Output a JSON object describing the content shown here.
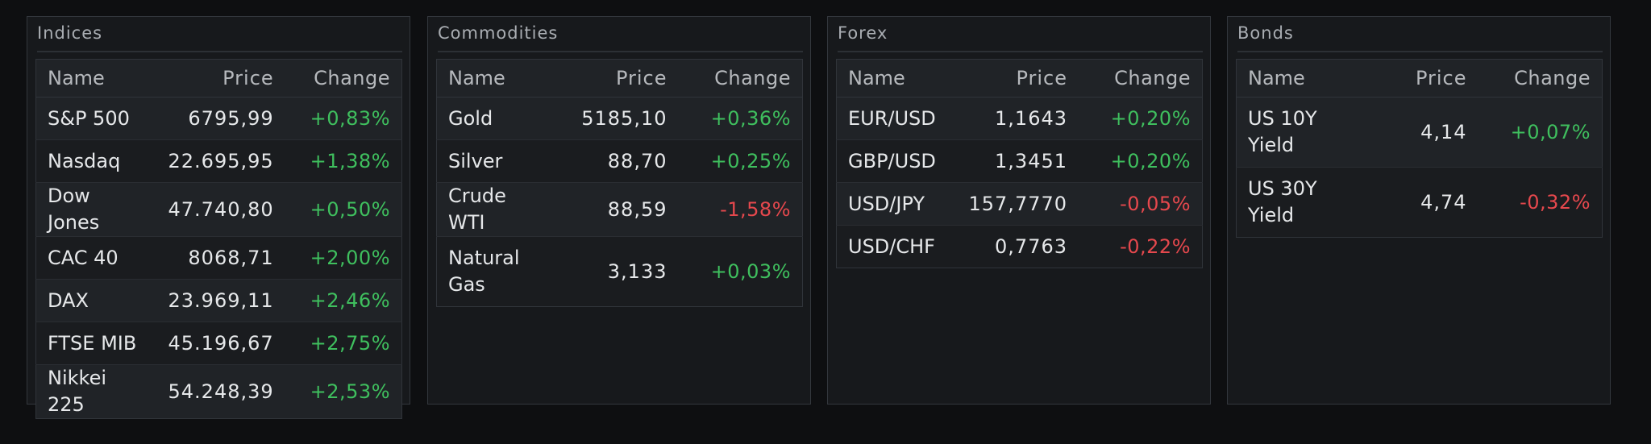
{
  "headers": {
    "name": "Name",
    "price": "Price",
    "change": "Change"
  },
  "panels": [
    {
      "title": "Indices",
      "rows": [
        {
          "name": "S&P 500",
          "price": "6795,99",
          "change": "+0,83%",
          "dir": "up"
        },
        {
          "name": "Nasdaq",
          "price": "22.695,95",
          "change": "+1,38%",
          "dir": "up"
        },
        {
          "name": "Dow Jones",
          "price": "47.740,80",
          "change": "+0,50%",
          "dir": "up"
        },
        {
          "name": "CAC 40",
          "price": "8068,71",
          "change": "+2,00%",
          "dir": "up"
        },
        {
          "name": "DAX",
          "price": "23.969,11",
          "change": "+2,46%",
          "dir": "up"
        },
        {
          "name": "FTSE MIB",
          "price": "45.196,67",
          "change": "+2,75%",
          "dir": "up"
        },
        {
          "name": "Nikkei 225",
          "price": "54.248,39",
          "change": "+2,53%",
          "dir": "up"
        }
      ]
    },
    {
      "title": "Commodities",
      "rows": [
        {
          "name": "Gold",
          "price": "5185,10",
          "change": "+0,36%",
          "dir": "up"
        },
        {
          "name": "Silver",
          "price": "88,70",
          "change": "+0,25%",
          "dir": "up"
        },
        {
          "name": "Crude WTI",
          "price": "88,59",
          "change": "-1,58%",
          "dir": "down"
        },
        {
          "name": "Natural Gas",
          "price": "3,133",
          "change": "+0,03%",
          "dir": "up"
        }
      ]
    },
    {
      "title": "Forex",
      "rows": [
        {
          "name": "EUR/USD",
          "price": "1,1643",
          "change": "+0,20%",
          "dir": "up"
        },
        {
          "name": "GBP/USD",
          "price": "1,3451",
          "change": "+0,20%",
          "dir": "up"
        },
        {
          "name": "USD/JPY",
          "price": "157,7770",
          "change": "-0,05%",
          "dir": "down"
        },
        {
          "name": "USD/CHF",
          "price": "0,7763",
          "change": "-0,22%",
          "dir": "down"
        }
      ]
    },
    {
      "title": "Bonds",
      "rows": [
        {
          "name": "US 10Y Yield",
          "price": "4,14",
          "change": "+0,07%",
          "dir": "up"
        },
        {
          "name": "US 30Y Yield",
          "price": "4,74",
          "change": "-0,32%",
          "dir": "down"
        }
      ]
    }
  ],
  "colors": {
    "background": "#0e0f11",
    "panel": "#17191c",
    "positive": "#3fbf5e",
    "negative": "#e5484d"
  }
}
